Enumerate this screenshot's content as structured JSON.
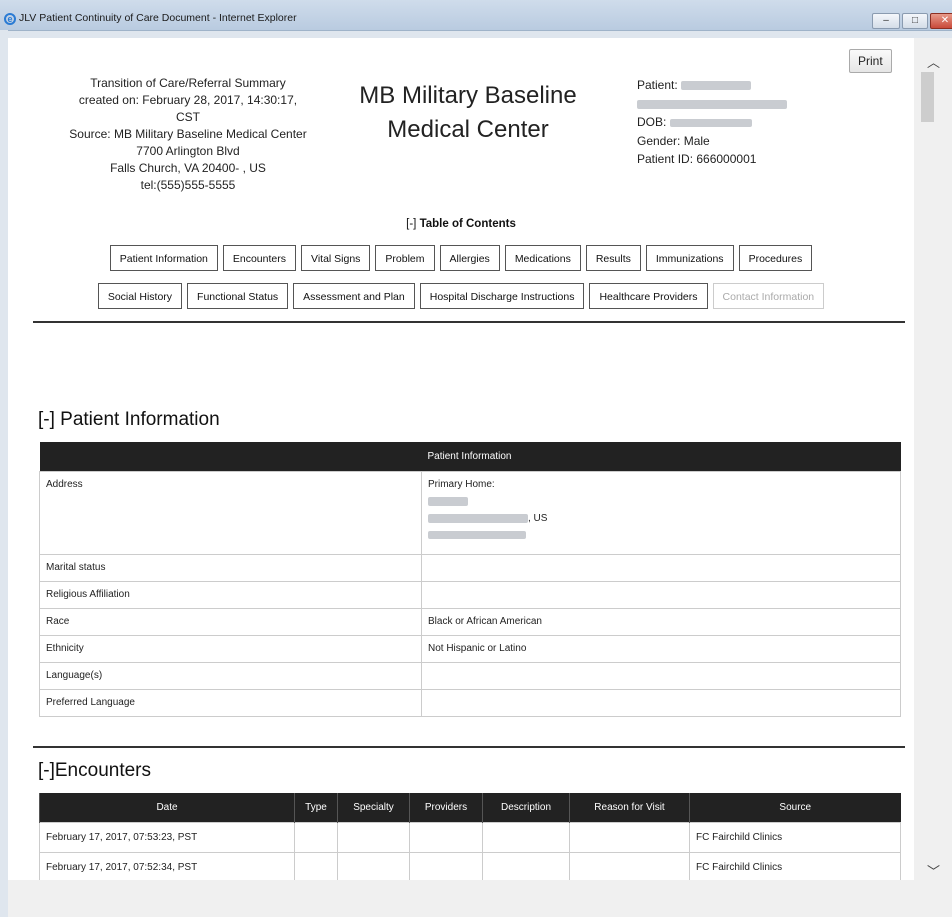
{
  "window": {
    "title": "JLV Patient Continuity of Care Document - Internet Explorer"
  },
  "header": {
    "left": [
      "Transition of Care/Referral Summary",
      "created on: February 28, 2017, 14:30:17,",
      "CST",
      "Source: MB Military Baseline Medical Center",
      "7700 Arlington Blvd",
      "Falls Church, VA 20400- , US",
      "tel:(555)555-5555"
    ],
    "facility": [
      "MB Military Baseline",
      "Medical Center"
    ],
    "patient_label": "Patient:",
    "dob_label": "DOB:",
    "gender": "Gender: Male",
    "patient_id": "Patient ID: 666000001",
    "print_label": "Print"
  },
  "toc": {
    "toggle": "[-]",
    "title": "Table of Contents",
    "row1": [
      "Patient Information",
      "Encounters",
      "Vital Signs",
      "Problem",
      "Allergies",
      "Medications",
      "Results",
      "Immunizations",
      "Procedures"
    ],
    "row2": [
      "Social History",
      "Functional Status",
      "Assessment and Plan",
      "Hospital Discharge Instructions",
      "Healthcare Providers",
      "Contact Information"
    ]
  },
  "patient_info": {
    "heading": "[-] Patient Information",
    "table_header": "Patient Information",
    "address_label": "Address",
    "address_primary": "Primary Home:",
    "address_country": ", US",
    "rows": [
      {
        "label": "Marital status",
        "value": ""
      },
      {
        "label": "Religious Affiliation",
        "value": ""
      },
      {
        "label": "Race",
        "value": "Black or African American"
      },
      {
        "label": "Ethnicity",
        "value": "Not Hispanic or Latino"
      },
      {
        "label": "Language(s)",
        "value": ""
      },
      {
        "label": "Preferred Language",
        "value": ""
      }
    ]
  },
  "encounters": {
    "heading": "[-]Encounters",
    "columns": [
      "Date",
      "Type",
      "Specialty",
      "Providers",
      "Description",
      "Reason for Visit",
      "Source"
    ],
    "rows": [
      [
        "February 17, 2017, 07:53:23, PST",
        "",
        "",
        "",
        "",
        "",
        "FC Fairchild Clinics"
      ],
      [
        "February 17, 2017, 07:52:34, PST",
        "",
        "",
        "",
        "",
        "",
        "FC Fairchild Clinics"
      ]
    ]
  }
}
